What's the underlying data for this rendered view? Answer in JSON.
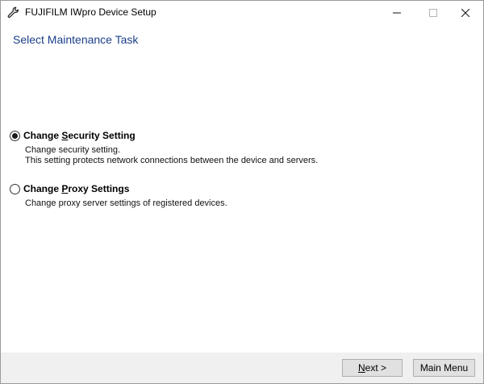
{
  "window": {
    "title": "FUJIFILM IWpro Device Setup",
    "icon": "wrench-icon"
  },
  "heading": "Select Maintenance Task",
  "options": [
    {
      "label_pre": "Change ",
      "label_access": "S",
      "label_post": "ecurity Setting",
      "selected": true,
      "desc": [
        "Change security setting.",
        "This setting protects network connections between the device and servers."
      ]
    },
    {
      "label_pre": "Change ",
      "label_access": "P",
      "label_post": "roxy Settings",
      "selected": false,
      "desc": [
        "Change proxy server settings of registered devices."
      ]
    }
  ],
  "buttons": {
    "next_label_access": "N",
    "next_label_post": "ext >",
    "main_menu": "Main Menu"
  },
  "colors": {
    "heading": "#1b3f8b",
    "footer": "#f0f0f0",
    "button": "#e1e1e1"
  }
}
